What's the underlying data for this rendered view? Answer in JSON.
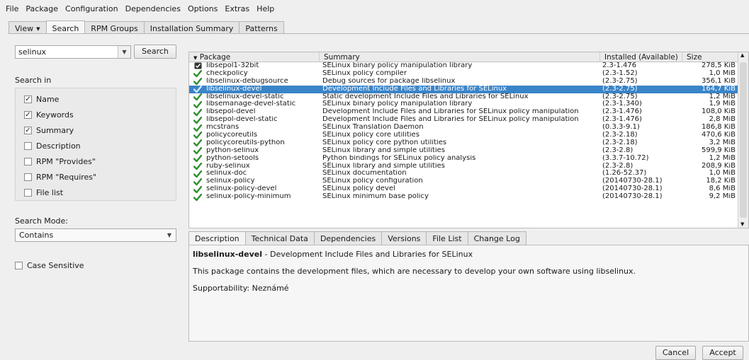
{
  "menu": [
    "File",
    "Package",
    "Configuration",
    "Dependencies",
    "Options",
    "Extras",
    "Help"
  ],
  "top_tabs": [
    {
      "label": "View"
    },
    {
      "label": "Search"
    },
    {
      "label": "RPM Groups"
    },
    {
      "label": "Installation Summary"
    },
    {
      "label": "Patterns"
    }
  ],
  "search": {
    "value": "selinux",
    "button": "Search"
  },
  "search_in": {
    "title": "Search in",
    "options": [
      {
        "label": "Name",
        "checked": true
      },
      {
        "label": "Keywords",
        "checked": true
      },
      {
        "label": "Summary",
        "checked": true
      },
      {
        "label": "Description",
        "checked": false
      },
      {
        "label": "RPM \"Provides\"",
        "checked": false
      },
      {
        "label": "RPM \"Requires\"",
        "checked": false
      },
      {
        "label": "File list",
        "checked": false
      }
    ]
  },
  "search_mode": {
    "label": "Search Mode:",
    "value": "Contains"
  },
  "case_sensitive": {
    "label": "Case Sensitive",
    "checked": false
  },
  "table": {
    "headers": [
      "Package",
      "Summary",
      "Installed (Available)",
      "Size"
    ],
    "rows": [
      {
        "status": "protected",
        "package": "libsepol1-32bit",
        "summary": "SELinux binary policy manipulation library",
        "installed": "2.3-1.476",
        "size": "278,5 KiB"
      },
      {
        "status": "installed",
        "package": "checkpolicy",
        "summary": "SELinux policy compiler",
        "installed": "(2.3-1.52)",
        "size": "1,0 MiB"
      },
      {
        "status": "installed",
        "package": "libselinux-debugsource",
        "summary": "Debug sources for package libselinux",
        "installed": "(2.3-2.75)",
        "size": "356,1 KiB"
      },
      {
        "status": "installed",
        "package": "libselinux-devel",
        "summary": "Development Include Files and Libraries for SELinux",
        "installed": "(2.3-2.75)",
        "size": "164,7 KiB",
        "selected": true
      },
      {
        "status": "installed",
        "package": "libselinux-devel-static",
        "summary": "Static development Include Files and Libraries for SELinux",
        "installed": "(2.3-2.75)",
        "size": "1,2 MiB"
      },
      {
        "status": "installed",
        "package": "libsemanage-devel-static",
        "summary": "SELinux binary policy manipulation library",
        "installed": "(2.3-1.340)",
        "size": "1,9 MiB"
      },
      {
        "status": "installed",
        "package": "libsepol-devel",
        "summary": "Development Include Files and Libraries for SELinux policy manipulation",
        "installed": "(2.3-1.476)",
        "size": "108,0 KiB"
      },
      {
        "status": "installed",
        "package": "libsepol-devel-static",
        "summary": "Development Include Files and Libraries for SELinux policy manipulation",
        "installed": "(2.3-1.476)",
        "size": "2,8 MiB"
      },
      {
        "status": "installed",
        "package": "mcstrans",
        "summary": "SELinux Translation Daemon",
        "installed": "(0.3.3-9.1)",
        "size": "186,8 KiB"
      },
      {
        "status": "installed",
        "package": "policycoreutils",
        "summary": "SELinux policy core utilities",
        "installed": "(2.3-2.18)",
        "size": "470,6 KiB"
      },
      {
        "status": "installed",
        "package": "policycoreutils-python",
        "summary": "SELinux policy core python utilities",
        "installed": "(2.3-2.18)",
        "size": "3,2 MiB"
      },
      {
        "status": "installed",
        "package": "python-selinux",
        "summary": "SELinux library and simple utilities",
        "installed": "(2.3-2.8)",
        "size": "599,9 KiB"
      },
      {
        "status": "installed",
        "package": "python-setools",
        "summary": "Python bindings for SELinux policy analysis",
        "installed": "(3.3.7-10.72)",
        "size": "1,2 MiB"
      },
      {
        "status": "installed",
        "package": "ruby-selinux",
        "summary": "SELinux library and simple utilities",
        "installed": "(2.3-2.8)",
        "size": "208,9 KiB"
      },
      {
        "status": "installed",
        "package": "selinux-doc",
        "summary": "SELinux documentation",
        "installed": "(1.26-52.37)",
        "size": "1,0 MiB"
      },
      {
        "status": "installed",
        "package": "selinux-policy",
        "summary": "SELinux policy configuration",
        "installed": "(20140730-28.1)",
        "size": "18,2 KiB"
      },
      {
        "status": "installed",
        "package": "selinux-policy-devel",
        "summary": "SELinux policy devel",
        "installed": "(20140730-28.1)",
        "size": "8,6 MiB"
      },
      {
        "status": "installed",
        "package": "selinux-policy-minimum",
        "summary": "SELinux minimum base policy",
        "installed": "(20140730-28.1)",
        "size": "9,2 MiB"
      }
    ]
  },
  "detail_tabs": [
    "Description",
    "Technical Data",
    "Dependencies",
    "Versions",
    "File List",
    "Change Log"
  ],
  "detail": {
    "name": "libselinux-devel",
    "summary": " - Development Include Files and Libraries for SELinux",
    "description": "This package contains the development files, which are necessary to develop your own software using libselinux.",
    "supportability": "Supportability: Neznámé"
  },
  "buttons": {
    "cancel": "Cancel",
    "accept": "Accept"
  },
  "colors": {
    "selection": "#3a84c8",
    "check": "#2f8f2f"
  }
}
